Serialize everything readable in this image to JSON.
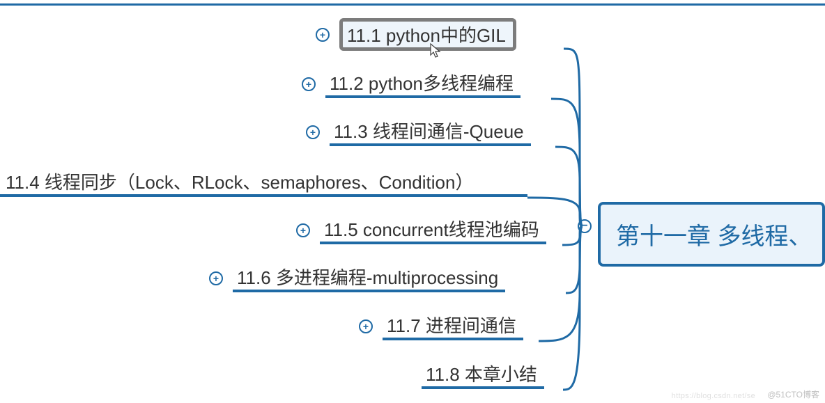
{
  "root": {
    "title": "第十一章 多线程、"
  },
  "nodes": [
    {
      "id": "n1",
      "label": "11.1 python中的GIL",
      "expandable": true,
      "selected": true
    },
    {
      "id": "n2",
      "label": "11.2 python多线程编程",
      "expandable": true
    },
    {
      "id": "n3",
      "label": "11.3 线程间通信-Queue",
      "expandable": true
    },
    {
      "id": "n4",
      "label": "11.4 线程同步（Lock、RLock、semaphores、Condition）",
      "expandable": false
    },
    {
      "id": "n5",
      "label": "11.5 concurrent线程池编码",
      "expandable": true
    },
    {
      "id": "n6",
      "label": "11.6 多进程编程-multiprocessing",
      "expandable": true
    },
    {
      "id": "n7",
      "label": "11.7 进程间通信",
      "expandable": true
    },
    {
      "id": "n8",
      "label": "11.8 本章小结",
      "expandable": false
    }
  ],
  "watermark": "@51CTO博客",
  "watermark2": "https://blog.csdn.net/se"
}
